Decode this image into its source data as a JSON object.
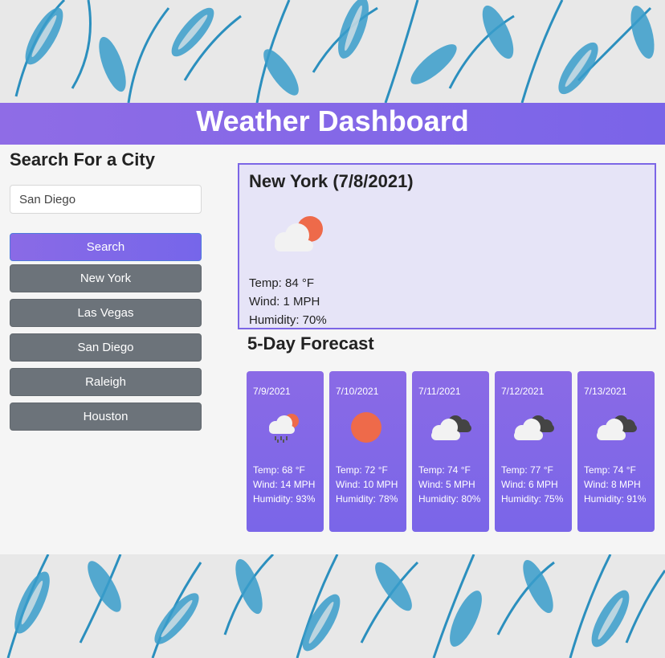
{
  "app": {
    "title": "Weather Dashboard"
  },
  "search": {
    "heading": "Search For a City",
    "input_value": "San Diego",
    "button_label": "Search",
    "history": [
      "New York",
      "Las Vegas",
      "San Diego",
      "Raleigh",
      "Houston"
    ]
  },
  "current": {
    "heading": "New York (7/8/2021)",
    "icon": "sun-behind-cloud-icon",
    "temp": "Temp: 84 °F",
    "wind": "Wind: 1 MPH",
    "humidity": "Humidity: 70%"
  },
  "forecast": {
    "heading": "5-Day Forecast",
    "days": [
      {
        "date": "7/9/2021",
        "icon": "rain-cloud-sun-icon",
        "temp": "Temp: 68 °F",
        "wind": "Wind: 14 MPH",
        "humidity": "Humidity: 93%"
      },
      {
        "date": "7/10/2021",
        "icon": "sun-icon",
        "temp": "Temp: 72 °F",
        "wind": "Wind: 10 MPH",
        "humidity": "Humidity: 78%"
      },
      {
        "date": "7/11/2021",
        "icon": "clouds-icon",
        "temp": "Temp: 74 °F",
        "wind": "Wind: 5 MPH",
        "humidity": "Humidity: 80%"
      },
      {
        "date": "7/12/2021",
        "icon": "clouds-icon",
        "temp": "Temp: 77 °F",
        "wind": "Wind: 6 MPH",
        "humidity": "Humidity: 75%"
      },
      {
        "date": "7/13/2021",
        "icon": "clouds-icon",
        "temp": "Temp: 74 °F",
        "wind": "Wind: 8 MPH",
        "humidity": "Humidity: 91%"
      }
    ]
  },
  "colors": {
    "accent_purple": "#7f67e8",
    "history_button": "#6c737a",
    "current_bg": "#e6e4f7",
    "feather_blue": "#2a8fbd"
  }
}
